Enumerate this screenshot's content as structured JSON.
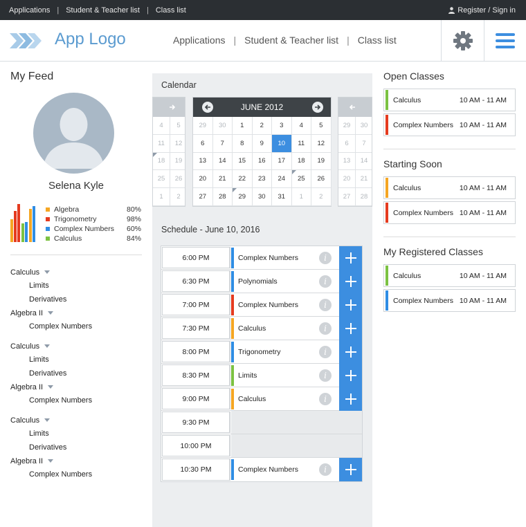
{
  "topbar": {
    "links": [
      "Applications",
      "Student & Teacher list",
      "Class list"
    ],
    "register": "Register / Sign in"
  },
  "header": {
    "logo": "App Logo",
    "nav": [
      "Applications",
      "Student & Teacher list",
      "Class list"
    ]
  },
  "feed": {
    "title": "My Feed",
    "user": "Selena Kyle",
    "grades": [
      {
        "name": "Algebra",
        "value": "80%",
        "color": "#f5a623"
      },
      {
        "name": "Trigonometry",
        "value": "98%",
        "color": "#e53b1f"
      },
      {
        "name": "Complex Numbers",
        "value": "60%",
        "color": "#2f8de4"
      },
      {
        "name": "Calculus",
        "value": "84%",
        "color": "#7cc242"
      }
    ],
    "topics": [
      {
        "label": "Calculus",
        "level": 0,
        "caret": true
      },
      {
        "label": "Limits",
        "level": 1
      },
      {
        "label": "Derivatives",
        "level": 1
      },
      {
        "label": "Algebra II",
        "level": 0,
        "caret": true
      },
      {
        "label": "Complex Numbers",
        "level": 1
      },
      {
        "gap": true
      },
      {
        "label": "Calculus",
        "level": 0,
        "caret": true
      },
      {
        "label": "Limits",
        "level": 1
      },
      {
        "label": "Derivatives",
        "level": 1
      },
      {
        "label": "Algebra II",
        "level": 0,
        "caret": true
      },
      {
        "label": "Complex Numbers",
        "level": 1
      },
      {
        "gap": true
      },
      {
        "label": "Calculus",
        "level": 0,
        "caret": true
      },
      {
        "label": "Limits",
        "level": 1
      },
      {
        "label": "Derivatives",
        "level": 1
      },
      {
        "label": "Algebra II",
        "level": 0,
        "caret": true
      },
      {
        "label": "Complex Numbers",
        "level": 1
      }
    ]
  },
  "calendar": {
    "title": "Calendar",
    "month": "JUNE 2012",
    "weeks": [
      [
        29,
        30,
        1,
        2,
        3,
        4,
        5
      ],
      [
        6,
        7,
        8,
        9,
        10,
        11,
        12
      ],
      [
        13,
        14,
        15,
        16,
        17,
        18,
        19
      ],
      [
        20,
        21,
        22,
        23,
        24,
        25,
        26
      ],
      [
        27,
        28,
        29,
        30,
        31,
        1,
        2
      ]
    ],
    "prev_weeks": [
      [
        4,
        5
      ],
      [
        11,
        12
      ],
      [
        18,
        19
      ],
      [
        25,
        26
      ],
      [
        1,
        2
      ]
    ],
    "next_weeks": [
      [
        29,
        30
      ],
      [
        6,
        7
      ],
      [
        13,
        14
      ],
      [
        20,
        21
      ],
      [
        27,
        28
      ]
    ],
    "selected": 10
  },
  "schedule": {
    "title": "Schedule - June 10, 2016",
    "rows": [
      {
        "time": "6:00 PM",
        "class": "Complex Numbers",
        "color": "#2f8de4"
      },
      {
        "time": "6:30 PM",
        "class": "Polynomials",
        "color": "#2f8de4"
      },
      {
        "time": "7:00 PM",
        "class": "Complex Numbers",
        "color": "#e53b1f"
      },
      {
        "time": "7:30 PM",
        "class": "Calculus",
        "color": "#f5a623"
      },
      {
        "time": "8:00 PM",
        "class": "Trigonometry",
        "color": "#2f8de4"
      },
      {
        "time": "8:30 PM",
        "class": "Limits",
        "color": "#7cc242"
      },
      {
        "time": "9:00 PM",
        "class": "Calculus",
        "color": "#f5a623"
      },
      {
        "time": "9:30 PM",
        "class": null
      },
      {
        "time": "10:00 PM",
        "class": null
      },
      {
        "time": "10:30 PM",
        "class": "Complex Numbers",
        "color": "#2f8de4"
      }
    ]
  },
  "right": {
    "open": {
      "title": "Open Classes",
      "items": [
        {
          "name": "Calculus",
          "time": "10 AM - 11 AM",
          "color": "#7cc242"
        },
        {
          "name": "Complex Numbers",
          "time": "10 AM - 11 AM",
          "color": "#e53b1f"
        }
      ]
    },
    "soon": {
      "title": "Starting Soon",
      "items": [
        {
          "name": "Calculus",
          "time": "10 AM - 11 AM",
          "color": "#f5a623"
        },
        {
          "name": "Complex Numbers",
          "time": "10 AM - 11 AM",
          "color": "#e53b1f"
        }
      ]
    },
    "registered": {
      "title": "My Registered Classes",
      "items": [
        {
          "name": "Calculus",
          "time": "10 AM - 11 AM",
          "color": "#7cc242"
        },
        {
          "name": "Complex Numbers",
          "time": "10 AM - 11 AM",
          "color": "#2f8de4"
        }
      ]
    }
  }
}
